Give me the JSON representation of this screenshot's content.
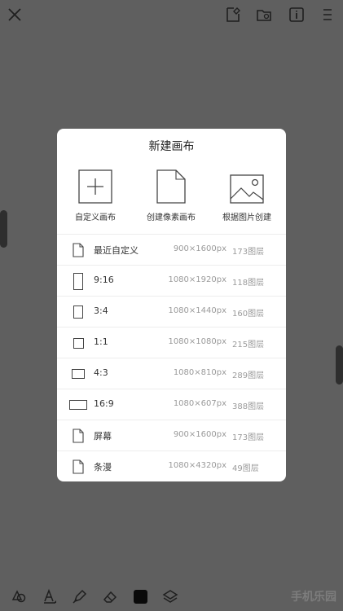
{
  "dialog": {
    "title": "新建画布",
    "options": [
      {
        "label": "自定义画布",
        "icon": "plus-square-icon"
      },
      {
        "label": "创建像素画布",
        "icon": "document-icon"
      },
      {
        "label": "根据图片创建",
        "icon": "image-icon"
      }
    ],
    "presets": [
      {
        "name": "最近自定义",
        "size": "900×1600px",
        "layers": "173图层",
        "icon": "document-icon"
      },
      {
        "name": "9:16",
        "size": "1080×1920px",
        "layers": "118图层",
        "icon": "ratio-9-16-icon"
      },
      {
        "name": "3:4",
        "size": "1080×1440px",
        "layers": "160图层",
        "icon": "ratio-3-4-icon"
      },
      {
        "name": "1:1",
        "size": "1080×1080px",
        "layers": "215图层",
        "icon": "ratio-1-1-icon"
      },
      {
        "name": "4:3",
        "size": "1080×810px",
        "layers": "289图层",
        "icon": "ratio-4-3-icon"
      },
      {
        "name": "16:9",
        "size": "1080×607px",
        "layers": "388图层",
        "icon": "ratio-16-9-icon"
      },
      {
        "name": "屏幕",
        "size": "900×1600px",
        "layers": "173图层",
        "icon": "document-icon"
      },
      {
        "name": "条漫",
        "size": "1080×4320px",
        "layers": "49图层",
        "icon": "document-icon"
      }
    ]
  },
  "watermark": "手机乐园",
  "colors": {
    "background": "#5f5f5f",
    "dialog": "#ffffff",
    "handle": "#2e2e2e",
    "icon": "#1f1f1f"
  }
}
